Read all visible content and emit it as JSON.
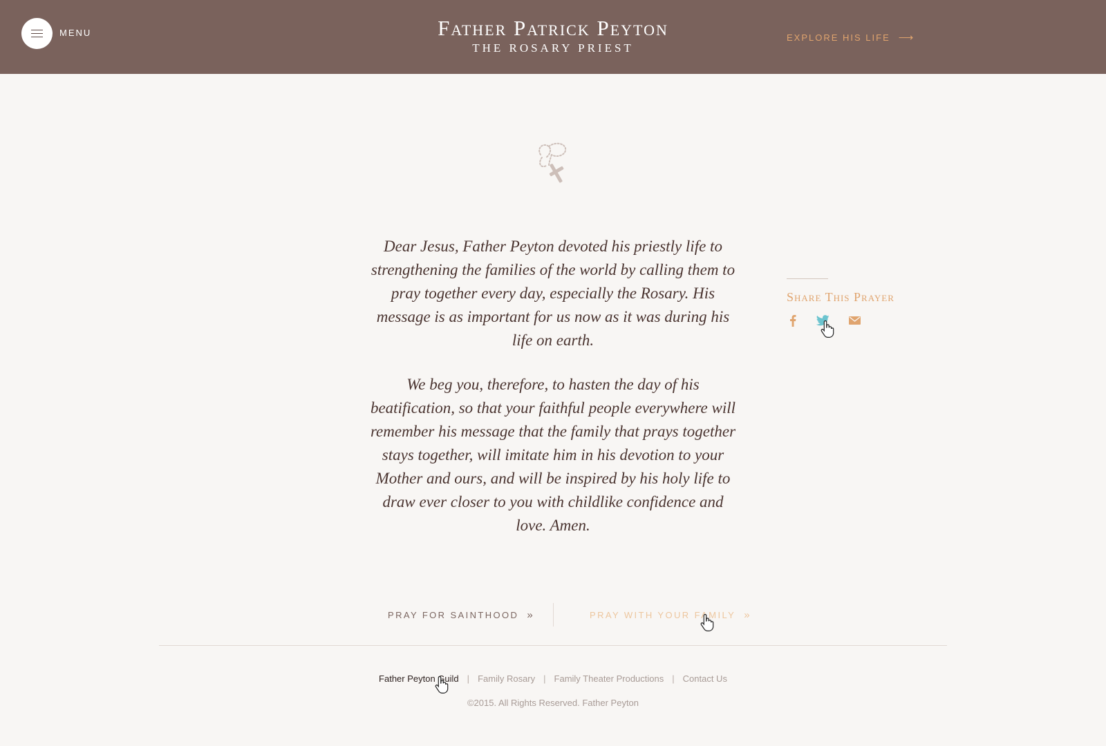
{
  "header": {
    "menu_label": "MENU",
    "brand_title": "Father Patrick Peyton",
    "brand_subtitle": "THE ROSARY PRIEST",
    "explore_label": "EXPLORE HIS LIFE",
    "background_color": "#7a625c",
    "accent_color": "#e0a46e"
  },
  "main": {
    "icon": "rosary-icon",
    "prayer_paragraphs": [
      "Dear Jesus, Father Peyton devoted his priestly life to strengthening the families of the world by calling them to pray together every day, especially the Rosary. His message is as important for us now as it was during his life on earth.",
      "We beg you, therefore, to hasten the day of his beatification, so that your faithful people everywhere will remember his message that the family that prays together stays together, will imitate him in his devotion to your Mother and ours, and will be inspired by his holy life to draw ever closer to you with childlike confidence and love. Amen."
    ]
  },
  "share": {
    "title": "Share This Prayer",
    "icons": [
      "facebook-icon",
      "twitter-icon",
      "email-icon"
    ],
    "twitter_hover_color": "#6cc4cf"
  },
  "bottom_nav": {
    "pray_sainthood": "PRAY FOR SAINTHOOD",
    "pray_family": "PRAY WITH YOUR FAMILY",
    "chevron": "»"
  },
  "footer": {
    "links": [
      "Father Peyton Guild",
      "Family Rosary",
      "Family Theater Productions",
      "Contact Us"
    ],
    "separator": "|",
    "copyright": "©2015. All Rights Reserved. Father Peyton"
  }
}
